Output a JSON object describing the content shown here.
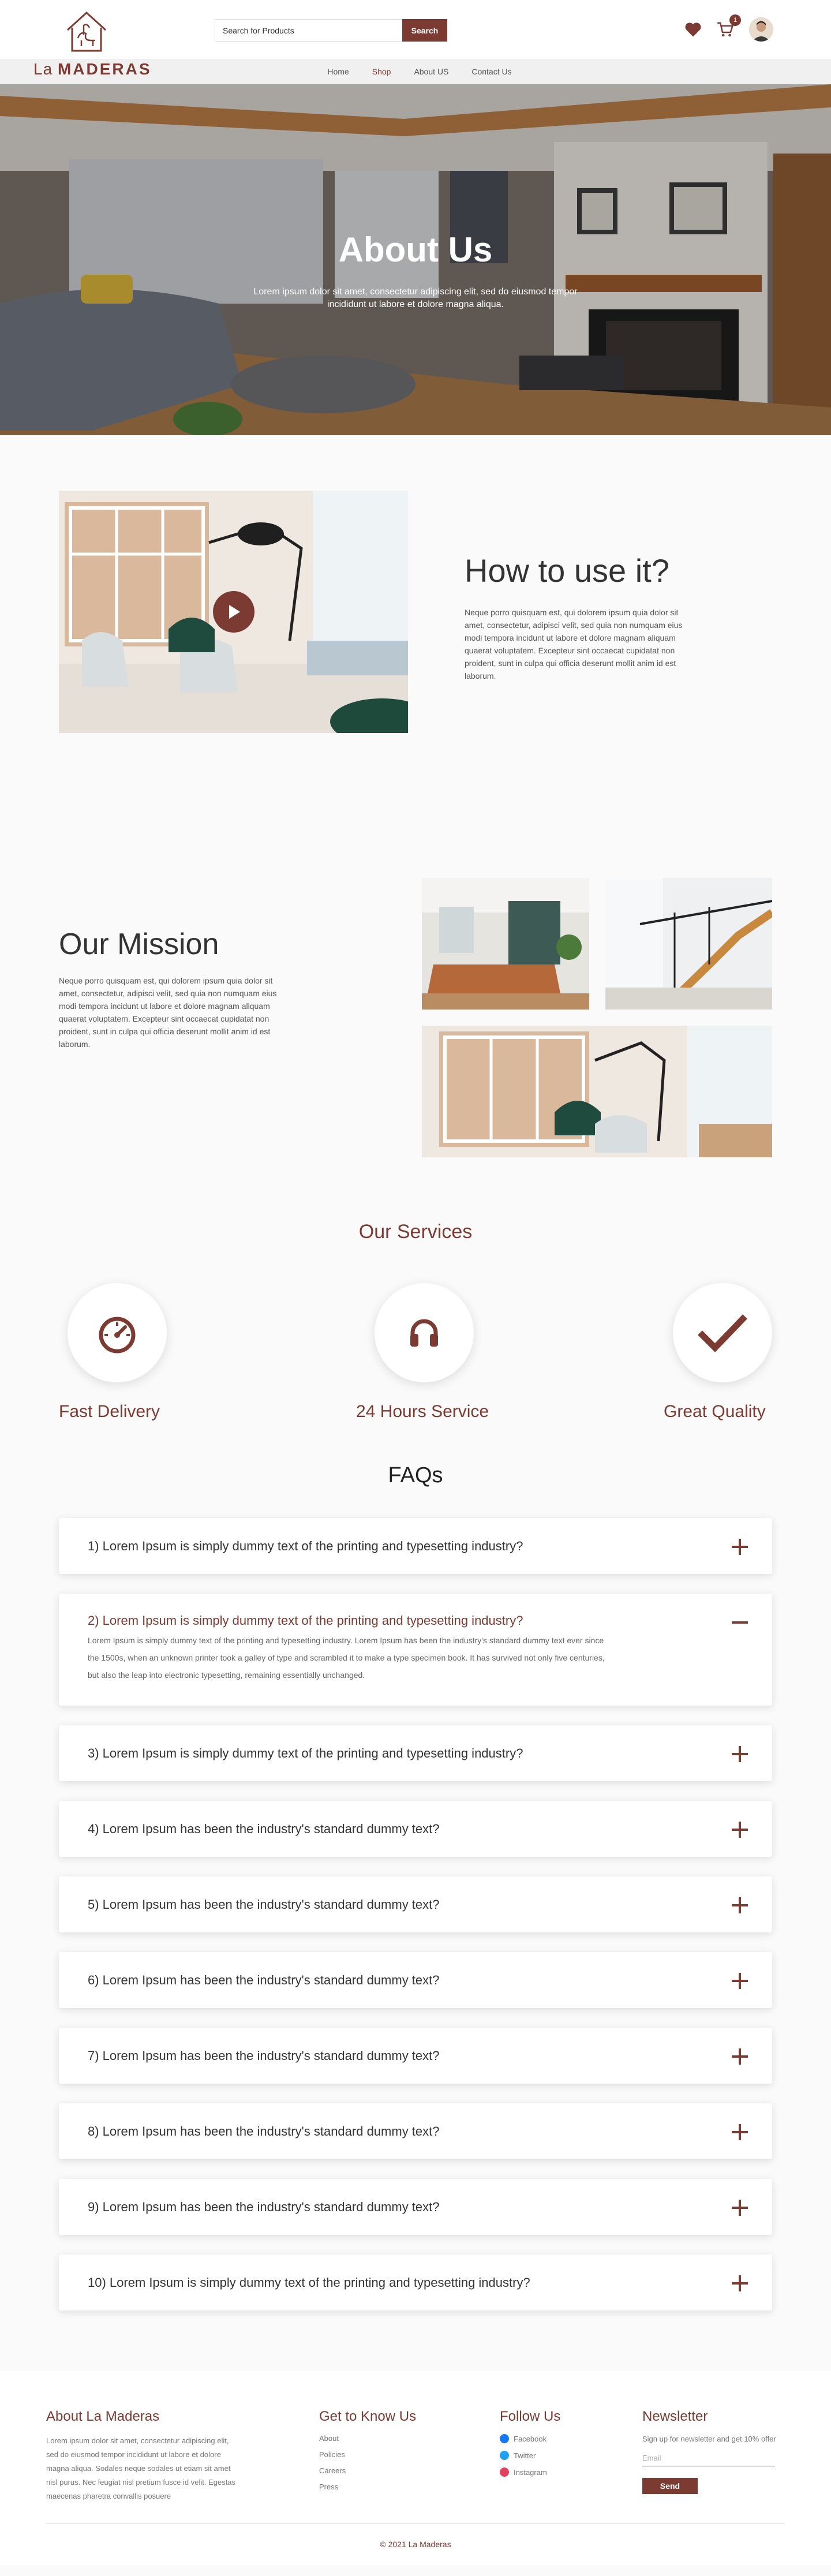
{
  "header": {
    "brand_prefix": "La",
    "brand_name": "MADERAS",
    "search_placeholder": "Search for Products",
    "search_button": "Search",
    "cart_count": "1"
  },
  "nav": [
    {
      "label": "Home",
      "active": false
    },
    {
      "label": "Shop",
      "active": true
    },
    {
      "label": "About US",
      "active": false
    },
    {
      "label": "Contact Us",
      "active": false
    }
  ],
  "hero": {
    "title": "About Us",
    "subtitle": "Lorem ipsum dolor sit amet, consectetur adipiscing elit, sed do eiusmod tempor incididunt ut labore et dolore magna aliqua."
  },
  "howto": {
    "title": "How to use it?",
    "body": "Neque porro quisquam est, qui dolorem ipsum quia dolor sit amet, consectetur, adipisci velit, sed quia non numquam eius modi tempora incidunt ut labore et dolore magnam aliquam quaerat voluptatem. Excepteur sint occaecat cupidatat non proident, sunt in culpa qui officia deserunt mollit anim id est laborum."
  },
  "mission": {
    "title": "Our Mission",
    "body": "Neque porro quisquam est, qui dolorem ipsum quia dolor sit amet, consectetur, adipisci velit, sed quia non numquam eius modi tempora incidunt ut labore et dolore magnam aliquam quaerat voluptatem. Excepteur sint occaecat cupidatat non proident, sunt in culpa qui officia deserunt mollit anim id est laborum."
  },
  "services": {
    "title": "Our Services",
    "items": [
      {
        "label": "Fast Delivery",
        "icon": "speedometer-icon"
      },
      {
        "label": "24 Hours Service",
        "icon": "headphones-icon"
      },
      {
        "label": "Great Quality",
        "icon": "checkmark-icon"
      }
    ]
  },
  "faqs": {
    "title": "FAQs",
    "items": [
      {
        "q": "1) Lorem Ipsum is simply dummy text of the printing and typesetting industry?"
      },
      {
        "q": "2) Lorem Ipsum is simply dummy text of the printing and typesetting industry?",
        "a": "Lorem Ipsum is simply dummy text of the printing and typesetting industry. Lorem Ipsum has been the industry's standard dummy text ever since the 1500s, when an unknown printer took a galley of type and scrambled it to make a type specimen book. It has survived not only five centuries, but also the leap into electronic typesetting, remaining essentially unchanged."
      },
      {
        "q": "3) Lorem Ipsum is simply dummy text of the printing and typesetting industry?"
      },
      {
        "q": "4) Lorem Ipsum has been the industry's standard dummy text?"
      },
      {
        "q": "5) Lorem Ipsum has been the industry's standard dummy text?"
      },
      {
        "q": "6) Lorem Ipsum has been the industry's standard dummy text?"
      },
      {
        "q": "7) Lorem Ipsum has been the industry's standard dummy text?"
      },
      {
        "q": "8)  Lorem Ipsum has been the industry's standard dummy text?"
      },
      {
        "q": "9) Lorem Ipsum has been the industry's standard dummy text?"
      },
      {
        "q": "10) Lorem Ipsum is simply dummy text of the printing and typesetting industry?"
      }
    ]
  },
  "footer": {
    "about_title": "About La Maderas",
    "about_text": "Lorem ipsum dolor sit amet, consectetur adipiscing elit, sed do eiusmod tempor incididunt ut labore et dolore magna aliqua. Sodales neque sodales ut etiam sit amet nisl purus. Nec feugiat nisl pretium fusce id velit. Egestas maecenas pharetra convallis posuere",
    "know_title": "Get to Know Us",
    "know_links": [
      "About",
      "Policies",
      "Careers",
      "Press"
    ],
    "follow_title": "Follow Us",
    "follow_links": [
      {
        "label": "Facebook",
        "color": "#1877f2"
      },
      {
        "label": "Twitter",
        "color": "#1da1f2"
      },
      {
        "label": "Instagram",
        "color": "#e4405f"
      }
    ],
    "newsletter_title": "Newsletter",
    "newsletter_text": "Sign up for newsletter and get 10% offer",
    "email_placeholder": "Email",
    "send_label": "Send",
    "copyright": "© 2021 La Maderas"
  },
  "colors": {
    "accent": "#7b3a32"
  }
}
